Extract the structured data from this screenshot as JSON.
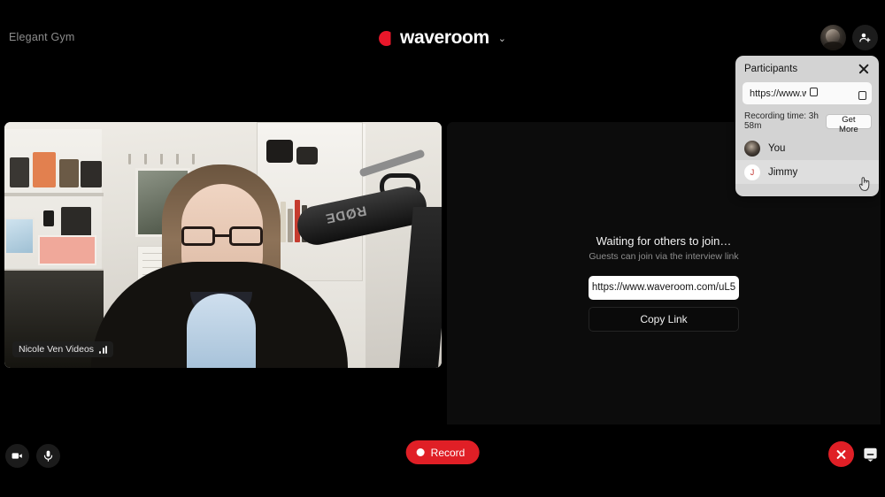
{
  "header": {
    "workspace": "Elegant Gym",
    "brand": "waveroom",
    "brand_caret": "⌄",
    "brand_mark_color": "#e8172a",
    "avatar_icon": "user-avatar-icon",
    "add_participant_icon": "add-person-icon"
  },
  "stage": {
    "self_tile": {
      "label": "Nicole Ven Videos",
      "audio_icon": "audio-level-icon",
      "mic_brand_text": "RØDE"
    },
    "empty_tile": {
      "title": "Waiting for others to join…",
      "subtitle": "Guests can join via the interview link",
      "link_value": "https://www.waveroom.com/uL5",
      "copy_button": "Copy Link"
    }
  },
  "participants_panel": {
    "title": "Participants",
    "close_icon": "close-icon",
    "link_value": "https://www.waveroom.cc",
    "copy_icon": "copy-icon",
    "recording_time": "Recording time: 3h 58m",
    "get_more": "Get More",
    "people": [
      {
        "name": "You",
        "avatar_type": "photo",
        "initial": ""
      },
      {
        "name": "Jimmy",
        "avatar_type": "initial",
        "initial": "J"
      }
    ]
  },
  "bottom_bar": {
    "camera_icon": "camera-icon",
    "microphone_icon": "microphone-icon",
    "record_label": "Record",
    "record_color": "#e01f26",
    "end_call_icon": "end-call-icon",
    "chat_icon": "chat-icon"
  },
  "cursor": {
    "type": "pointer-hand-cursor"
  }
}
